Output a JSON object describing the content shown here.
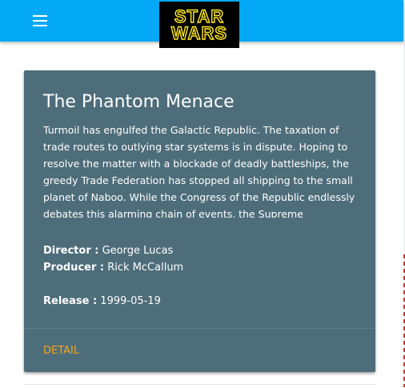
{
  "app_bar": {
    "logo_text": [
      "STAR",
      "WARS"
    ],
    "menu_icon": "hamburger-menu-icon",
    "color": "#03a9f4"
  },
  "film": {
    "title": "The Phantom Menace",
    "opening_crawl": "Turmoil has engulfed the Galactic Republic. The taxation of trade routes to outlying star systems is in dispute. Hoping to resolve the matter with a blockade of deadly battleships, the greedy Trade Federation has stopped all shipping to the small planet of Naboo. While the Congress of the Republic endlessly debates this alarming chain of events, the Supreme",
    "director_label": "Director :",
    "director": "George Lucas",
    "producer_label": "Producer :",
    "producer": "Rick McCallum",
    "release_label": "Release :",
    "release_date": "1999-05-19",
    "detail_label": "DETAIL"
  },
  "colors": {
    "card": "#4e6d7a",
    "accent": "#f5a623",
    "logo_yellow": "#ffe81f"
  }
}
